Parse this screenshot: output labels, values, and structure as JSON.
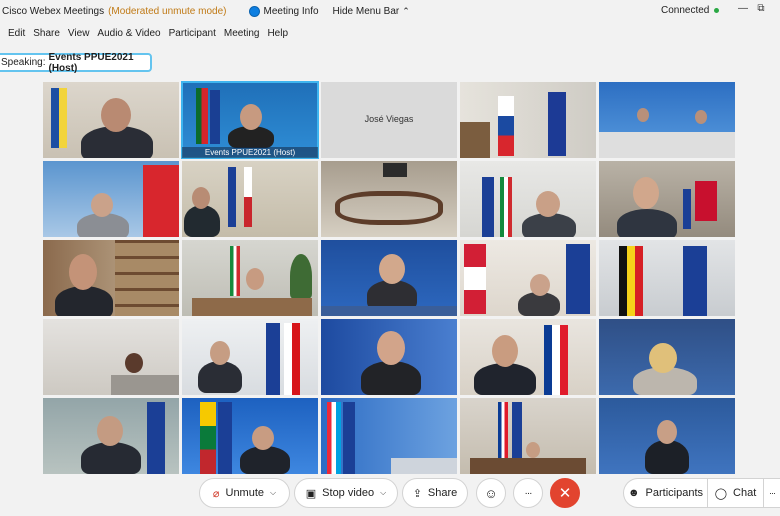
{
  "titlebar": {
    "app_title": "Cisco Webex Meetings",
    "mode": "(Moderated unmute mode)",
    "meeting_info": "Meeting Info",
    "hide_menu": "Hide Menu Bar",
    "connection_status": "Connected",
    "status_color": "#2aa844"
  },
  "menu": {
    "items": [
      "Edit",
      "Share",
      "View",
      "Audio & Video",
      "Participant",
      "Meeting",
      "Help"
    ]
  },
  "speaking": {
    "prefix": "Speaking:",
    "name": "Events PPUE2021 (Host)"
  },
  "grid": {
    "active_tile_label": "Events PPUE2021 (Host)",
    "placeholder_name": "José Viegas",
    "accent_color": "#3fb5ef"
  },
  "controls": {
    "unmute": "Unmute",
    "stop_video": "Stop video",
    "share": "Share",
    "participants": "Participants",
    "chat": "Chat",
    "more": "···",
    "end_color": "#e2442f"
  }
}
